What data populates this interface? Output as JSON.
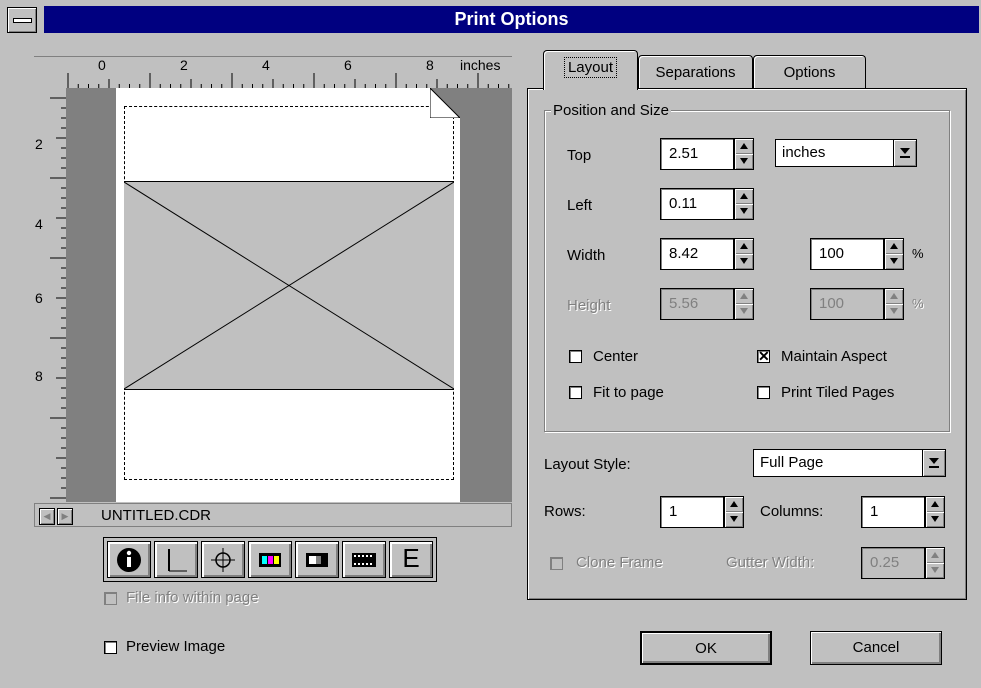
{
  "window": {
    "title": "Print Options"
  },
  "ruler": {
    "top_labels": [
      "0",
      "2",
      "4",
      "6",
      "8"
    ],
    "unit_label": "inches",
    "left_labels": [
      "2",
      "4",
      "6",
      "8"
    ]
  },
  "preview": {
    "filename": "UNTITLED.CDR"
  },
  "toolbar": {
    "buttons": [
      "info-icon",
      "crop-marks-icon",
      "registration-mark-icon",
      "color-bars-icon",
      "densitometer-icon",
      "film-icon",
      "emulsion-icon"
    ],
    "emulsion_glyph": "E"
  },
  "file_info": {
    "label": "File info within page",
    "checked": false,
    "enabled": false
  },
  "preview_image": {
    "label": "Preview Image",
    "checked": false
  },
  "tabs": [
    "Layout",
    "Separations",
    "Options"
  ],
  "active_tab": "Layout",
  "position_size": {
    "group_label": "Position and Size",
    "top": {
      "label": "Top",
      "value": "2.51"
    },
    "units": "inches",
    "left": {
      "label": "Left",
      "value": "0.11"
    },
    "width": {
      "label": "Width",
      "value": "8.42",
      "percent": "100"
    },
    "height": {
      "label": "Height",
      "value": "5.56",
      "percent": "100"
    },
    "percent_sign": "%",
    "center": {
      "label": "Center",
      "checked": false
    },
    "fit_to_page": {
      "label": "Fit to page",
      "checked": false
    },
    "maintain_aspect": {
      "label": "Maintain Aspect",
      "checked": true
    },
    "print_tiled": {
      "label": "Print Tiled Pages",
      "checked": false
    }
  },
  "layout_style": {
    "label": "Layout Style:",
    "value": "Full Page"
  },
  "rows": {
    "label": "Rows:",
    "value": "1"
  },
  "columns": {
    "label": "Columns:",
    "value": "1"
  },
  "clone_frame": {
    "label": "Clone Frame",
    "checked": false,
    "enabled": false
  },
  "gutter_width": {
    "label": "Gutter Width:",
    "value": "0.25"
  },
  "buttons": {
    "ok": "OK",
    "cancel": "Cancel"
  },
  "checkmark": "✕"
}
